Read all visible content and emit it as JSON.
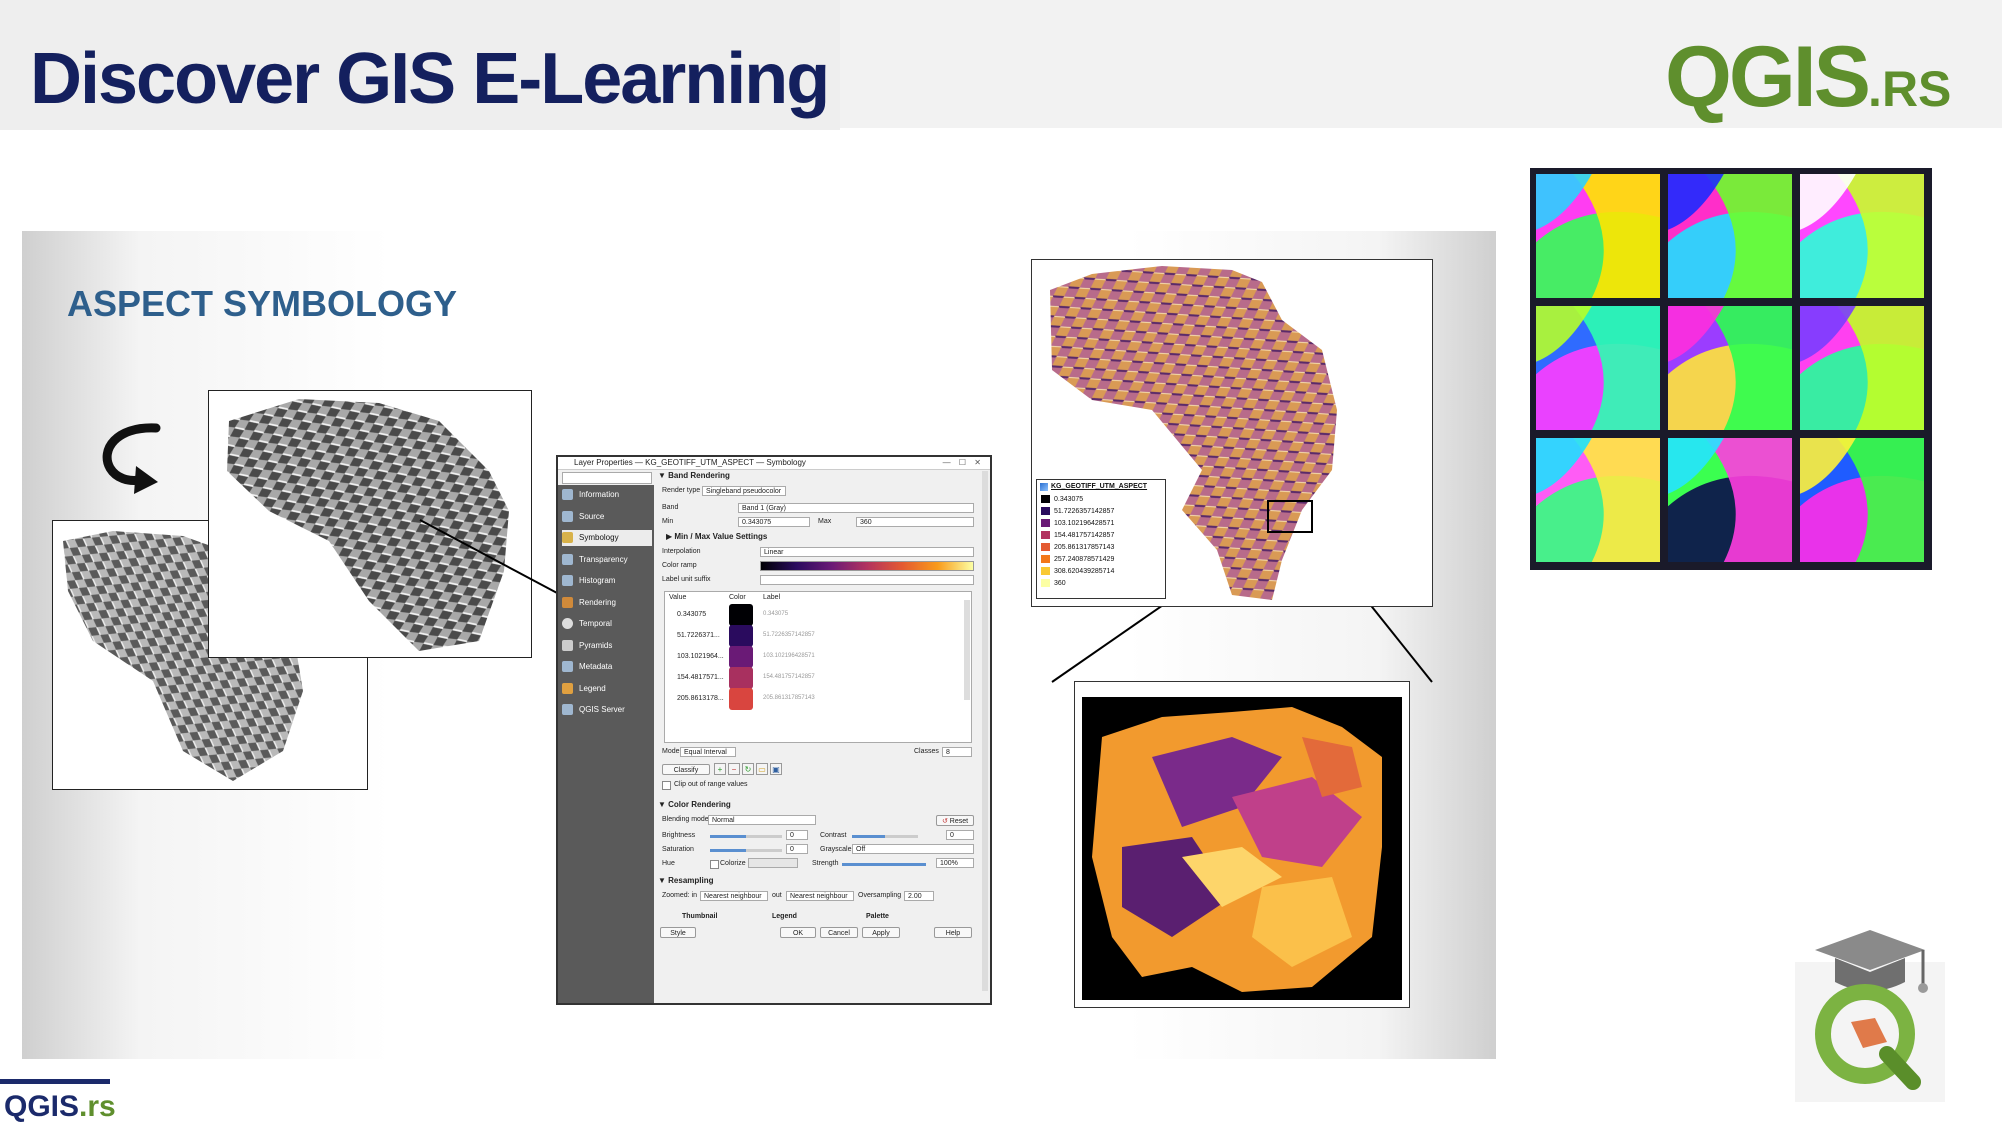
{
  "header": {
    "title": "Discover GIS E-Learning",
    "logo_main": "QGIS",
    "logo_suffix": ".RS"
  },
  "slide": {
    "title": "ASPECT SYMBOLOGY"
  },
  "dialog": {
    "title": "Layer Properties — KG_GEOTIFF_UTM_ASPECT — Symbology",
    "sidebar": [
      "Information",
      "Source",
      "Symbology",
      "Transparency",
      "Histogram",
      "Rendering",
      "Temporal",
      "Pyramids",
      "Metadata",
      "Legend",
      "QGIS Server"
    ],
    "band_rendering": {
      "section": "Band Rendering",
      "render_type_label": "Render type",
      "render_type": "Singleband pseudocolor",
      "band_label": "Band",
      "band": "Band 1 (Gray)",
      "min_label": "Min",
      "min": "0.343075",
      "max_label": "Max",
      "max": "360",
      "minmax_section": "Min / Max Value Settings",
      "interpolation_label": "Interpolation",
      "interpolation": "Linear",
      "color_ramp_label": "Color ramp",
      "unit_suffix_label": "Label unit suffix",
      "columns": [
        "Value",
        "Color",
        "Label"
      ],
      "rows": [
        {
          "value": "0.343075",
          "color": "#000004",
          "label": "0.343075"
        },
        {
          "value": "51.7226371...",
          "color": "#2a0b5e",
          "label": "51.7226357142857"
        },
        {
          "value": "103.1021964...",
          "color": "#6a1a76",
          "label": "103.102196428571"
        },
        {
          "value": "154.4817571...",
          "color": "#a8305f",
          "label": "154.481757142857"
        },
        {
          "value": "205.8613178...",
          "color": "#d9453f",
          "label": "205.861317857143"
        }
      ],
      "mode_label": "Mode",
      "mode": "Equal Interval",
      "classes_label": "Classes",
      "classes": "8",
      "classify": "Classify",
      "clip_label": "Clip out of range values"
    },
    "color_rendering": {
      "section": "Color Rendering",
      "blending_label": "Blending mode",
      "blending": "Normal",
      "reset": "Reset",
      "brightness_label": "Brightness",
      "brightness": "0",
      "contrast_label": "Contrast",
      "contrast": "0",
      "saturation_label": "Saturation",
      "saturation": "0",
      "grayscale_label": "Grayscale",
      "grayscale": "Off",
      "hue_label": "Hue",
      "colorize_label": "Colorize",
      "strength_label": "Strength",
      "strength": "100%"
    },
    "resampling": {
      "section": "Resampling",
      "zoomed_in_label": "Zoomed: in",
      "zoomed_in": "Nearest neighbour",
      "out_label": "out",
      "zoomed_out": "Nearest neighbour",
      "oversampling_label": "Oversampling",
      "oversampling": "2.00"
    },
    "tabs_bottom": [
      "Thumbnail",
      "Legend",
      "Palette"
    ],
    "buttons": {
      "style": "Style",
      "ok": "OK",
      "cancel": "Cancel",
      "apply": "Apply",
      "help": "Help"
    }
  },
  "legend": {
    "title": "KG_GEOTIFF_UTM_ASPECT",
    "entries": [
      {
        "label": "0.343075",
        "color": "#000004"
      },
      {
        "label": "51.7226357142857",
        "color": "#2a0b5e"
      },
      {
        "label": "103.102196428571",
        "color": "#6a1a76"
      },
      {
        "label": "154.481757142857",
        "color": "#b2325f"
      },
      {
        "label": "205.861317857143",
        "color": "#e45a31"
      },
      {
        "label": "257.240878571429",
        "color": "#f37819"
      },
      {
        "label": "308.620439285714",
        "color": "#f9c932"
      },
      {
        "label": "360",
        "color": "#fcffa4"
      }
    ]
  },
  "footer": {
    "logo_main": "QGIS",
    "logo_suffix": ".rs"
  },
  "colors": {
    "title_navy": "#14205e",
    "qgis_green": "#5f8f2d",
    "slide_title_blue": "#2e5f8c"
  }
}
